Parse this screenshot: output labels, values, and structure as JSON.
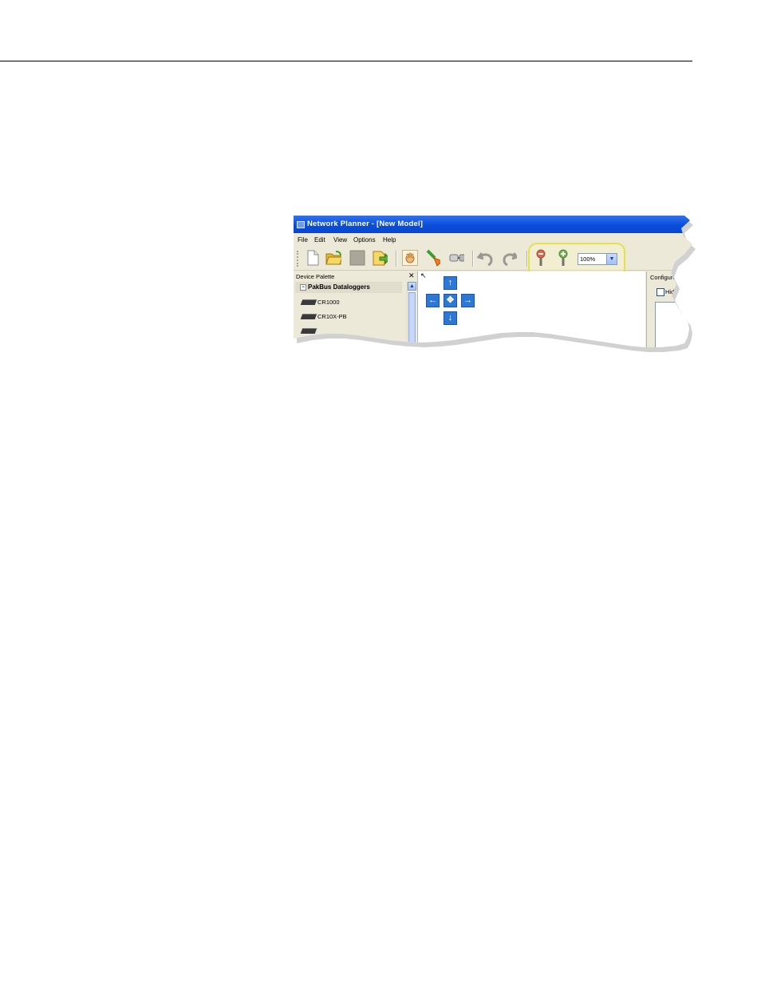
{
  "window": {
    "title": "Network Planner - [New Model]"
  },
  "menu": [
    "File",
    "Edit",
    "View",
    "Options",
    "Help"
  ],
  "toolbar": {
    "zoom_value": "100%",
    "icons": [
      "new-document-icon",
      "open-folder-icon",
      "save-icon",
      "export-icon",
      "pan-hand-icon",
      "add-link-icon",
      "connection-icon",
      "undo-icon",
      "redo-icon",
      "zoom-out-icon",
      "zoom-in-icon"
    ]
  },
  "palette": {
    "title": "Device Palette",
    "close": "✕",
    "group": "PakBus Dataloggers",
    "items": [
      "CR1000",
      "CR10X-PB"
    ]
  },
  "canvas": {
    "nav": {
      "up": "↑",
      "down": "↓",
      "left": "←",
      "right": "→",
      "center": "✥"
    }
  },
  "config": {
    "title": "Configure",
    "hide_label": "Hide Co"
  },
  "colors": {
    "highlight": "#e4e24a",
    "titlebar": "#0b4ddb",
    "nav": "#2c78d4"
  }
}
